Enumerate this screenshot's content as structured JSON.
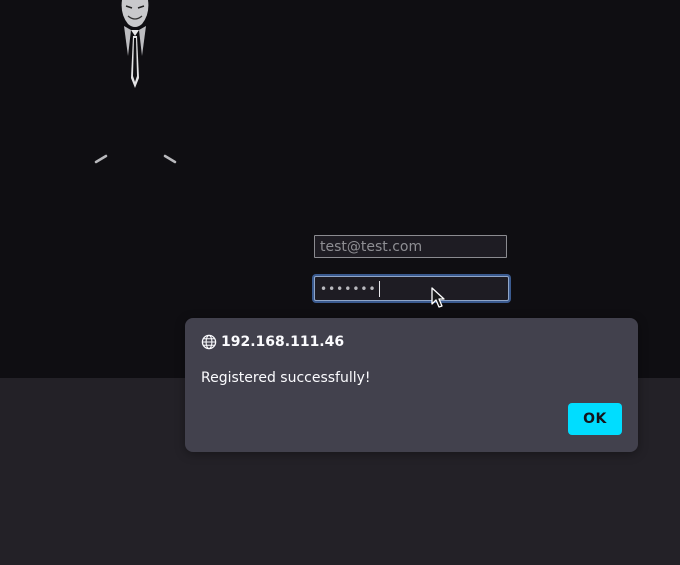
{
  "form": {
    "email_placeholder": "test@test.com",
    "password_masked": "•••••••"
  },
  "dialog": {
    "origin": "192.168.111.46",
    "origin_icon": "globe-icon",
    "message": "Registered successfully!",
    "ok_label": "OK"
  },
  "colors": {
    "page_background": "#0f0e12",
    "page_lower_background": "#232127",
    "dialog_background": "#42414d",
    "dialog_text": "#fbfbfe",
    "ok_button": "#00ddff",
    "ok_button_text": "#15141a",
    "focus_ring": "#3a5a8f"
  }
}
